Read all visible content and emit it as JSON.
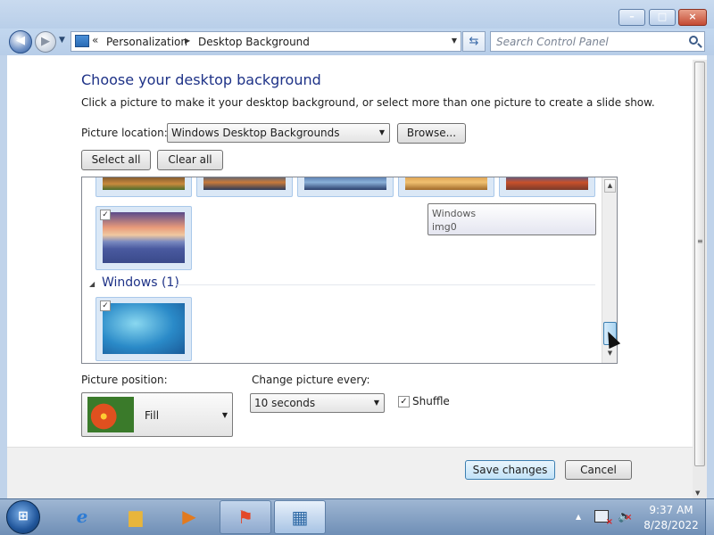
{
  "window": {
    "minimize_label": "–",
    "maximize_label": "□",
    "close_label": "×"
  },
  "nav": {
    "back_glyph": "◀",
    "forward_glyph": "▶",
    "breadcrumbs": [
      "Personalization",
      "Desktop Background"
    ],
    "search_placeholder": "Search Control Panel"
  },
  "page": {
    "heading": "Choose your desktop background",
    "subtext": "Click a picture to make it your desktop background, or select more than one picture to create a slide show.",
    "picture_location_label": "Picture location:",
    "picture_location_value": "Windows Desktop Backgrounds",
    "browse_label": "Browse...",
    "select_all_label": "Select all",
    "clear_all_label": "Clear all"
  },
  "gallery": {
    "group_name": "Windows (1)",
    "tooltip_line1": "Windows",
    "tooltip_line2": "img0",
    "thumbnails": [
      {
        "name": "row1-1",
        "checked": false
      },
      {
        "name": "row1-2",
        "checked": false
      },
      {
        "name": "row1-3",
        "checked": false
      },
      {
        "name": "row1-4",
        "checked": false
      },
      {
        "name": "row1-5",
        "checked": false
      },
      {
        "name": "sunset-lupines",
        "checked": true
      },
      {
        "name": "windows-img0",
        "checked": true
      }
    ]
  },
  "settings": {
    "position_label": "Picture position:",
    "position_value": "Fill",
    "change_label": "Change picture every:",
    "change_value": "10 seconds",
    "shuffle_label": "Shuffle",
    "shuffle_checked": true
  },
  "footer": {
    "save_label": "Save changes",
    "cancel_label": "Cancel"
  },
  "taskbar": {
    "clock_time": "9:37 AM",
    "clock_date": "8/28/2022"
  },
  "colors": {
    "heading": "#1e3287",
    "chrome": "#c0d3ea",
    "taskbar": "#6f8fb6"
  }
}
